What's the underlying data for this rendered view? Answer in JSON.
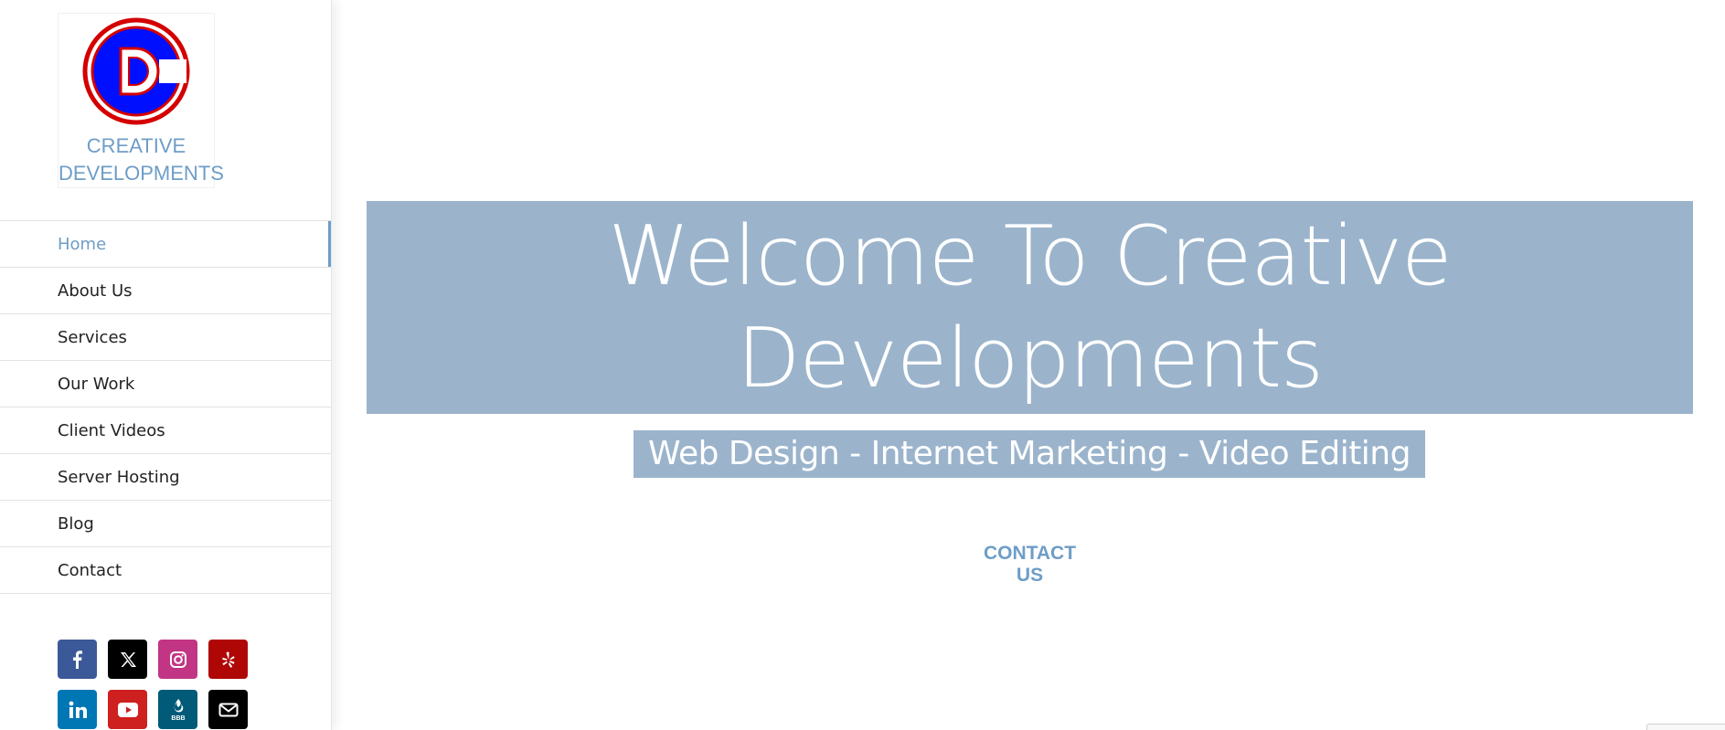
{
  "logo": {
    "alt": "CD",
    "line1": "CREATIVE",
    "line2": "DEVELOPMENTS"
  },
  "nav": {
    "items": [
      {
        "label": "Home",
        "active": true
      },
      {
        "label": "About Us"
      },
      {
        "label": "Services"
      },
      {
        "label": "Our Work"
      },
      {
        "label": "Client Videos"
      },
      {
        "label": "Server Hosting"
      },
      {
        "label": "Blog"
      },
      {
        "label": "Contact"
      }
    ]
  },
  "social": {
    "icons": [
      {
        "name": "facebook-icon",
        "color": "#3b5998"
      },
      {
        "name": "x-icon",
        "color": "#000000"
      },
      {
        "name": "instagram-icon",
        "color": "#c13584"
      },
      {
        "name": "yelp-icon",
        "color": "#af0606"
      },
      {
        "name": "linkedin-icon",
        "color": "#0077b5"
      },
      {
        "name": "youtube-icon",
        "color": "#cd201f"
      },
      {
        "name": "bbb-icon",
        "color": "#005a78",
        "text": "BBB"
      },
      {
        "name": "email-icon",
        "color": "#000000"
      }
    ]
  },
  "hero": {
    "title_line1": "Welcome To Creative",
    "title_line2": "Developments",
    "subtitle": "Web Design - Internet Marketing - Video Editing",
    "contact_label": "CONTACT US"
  },
  "colors": {
    "accent": "#6e9dc7",
    "banner": "#9bb4cc",
    "logo_red": "#d40000",
    "logo_blue": "#0010ff"
  }
}
